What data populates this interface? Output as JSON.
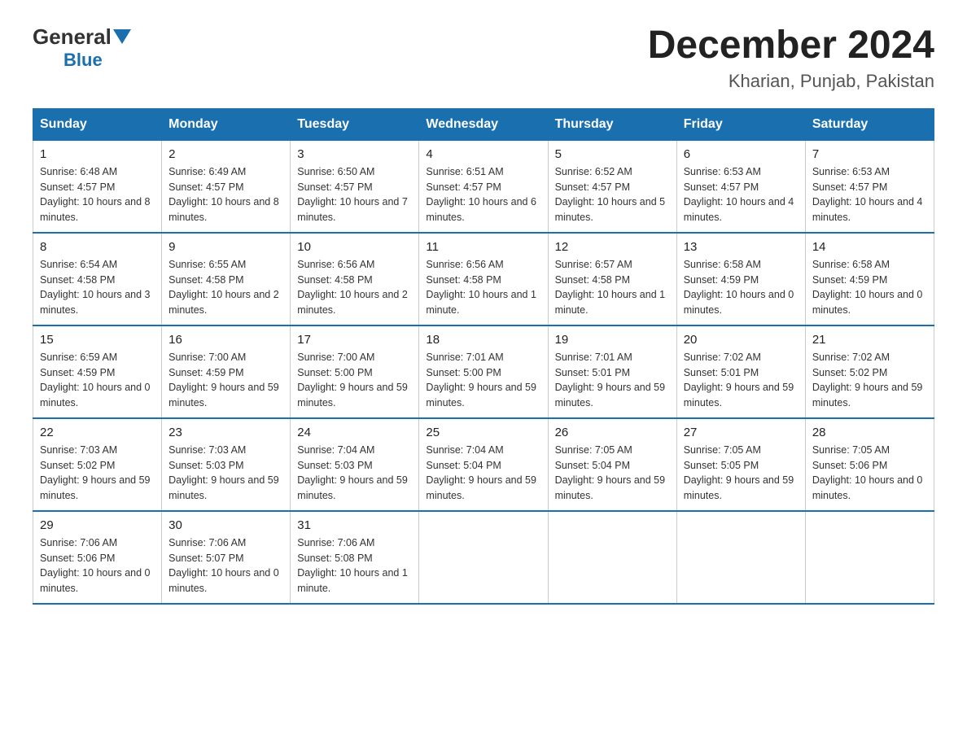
{
  "header": {
    "logo_general": "General",
    "logo_blue": "Blue",
    "month_title": "December 2024",
    "location": "Kharian, Punjab, Pakistan"
  },
  "days_of_week": [
    "Sunday",
    "Monday",
    "Tuesday",
    "Wednesday",
    "Thursday",
    "Friday",
    "Saturday"
  ],
  "weeks": [
    [
      {
        "day": "1",
        "sunrise": "Sunrise: 6:48 AM",
        "sunset": "Sunset: 4:57 PM",
        "daylight": "Daylight: 10 hours and 8 minutes."
      },
      {
        "day": "2",
        "sunrise": "Sunrise: 6:49 AM",
        "sunset": "Sunset: 4:57 PM",
        "daylight": "Daylight: 10 hours and 8 minutes."
      },
      {
        "day": "3",
        "sunrise": "Sunrise: 6:50 AM",
        "sunset": "Sunset: 4:57 PM",
        "daylight": "Daylight: 10 hours and 7 minutes."
      },
      {
        "day": "4",
        "sunrise": "Sunrise: 6:51 AM",
        "sunset": "Sunset: 4:57 PM",
        "daylight": "Daylight: 10 hours and 6 minutes."
      },
      {
        "day": "5",
        "sunrise": "Sunrise: 6:52 AM",
        "sunset": "Sunset: 4:57 PM",
        "daylight": "Daylight: 10 hours and 5 minutes."
      },
      {
        "day": "6",
        "sunrise": "Sunrise: 6:53 AM",
        "sunset": "Sunset: 4:57 PM",
        "daylight": "Daylight: 10 hours and 4 minutes."
      },
      {
        "day": "7",
        "sunrise": "Sunrise: 6:53 AM",
        "sunset": "Sunset: 4:57 PM",
        "daylight": "Daylight: 10 hours and 4 minutes."
      }
    ],
    [
      {
        "day": "8",
        "sunrise": "Sunrise: 6:54 AM",
        "sunset": "Sunset: 4:58 PM",
        "daylight": "Daylight: 10 hours and 3 minutes."
      },
      {
        "day": "9",
        "sunrise": "Sunrise: 6:55 AM",
        "sunset": "Sunset: 4:58 PM",
        "daylight": "Daylight: 10 hours and 2 minutes."
      },
      {
        "day": "10",
        "sunrise": "Sunrise: 6:56 AM",
        "sunset": "Sunset: 4:58 PM",
        "daylight": "Daylight: 10 hours and 2 minutes."
      },
      {
        "day": "11",
        "sunrise": "Sunrise: 6:56 AM",
        "sunset": "Sunset: 4:58 PM",
        "daylight": "Daylight: 10 hours and 1 minute."
      },
      {
        "day": "12",
        "sunrise": "Sunrise: 6:57 AM",
        "sunset": "Sunset: 4:58 PM",
        "daylight": "Daylight: 10 hours and 1 minute."
      },
      {
        "day": "13",
        "sunrise": "Sunrise: 6:58 AM",
        "sunset": "Sunset: 4:59 PM",
        "daylight": "Daylight: 10 hours and 0 minutes."
      },
      {
        "day": "14",
        "sunrise": "Sunrise: 6:58 AM",
        "sunset": "Sunset: 4:59 PM",
        "daylight": "Daylight: 10 hours and 0 minutes."
      }
    ],
    [
      {
        "day": "15",
        "sunrise": "Sunrise: 6:59 AM",
        "sunset": "Sunset: 4:59 PM",
        "daylight": "Daylight: 10 hours and 0 minutes."
      },
      {
        "day": "16",
        "sunrise": "Sunrise: 7:00 AM",
        "sunset": "Sunset: 4:59 PM",
        "daylight": "Daylight: 9 hours and 59 minutes."
      },
      {
        "day": "17",
        "sunrise": "Sunrise: 7:00 AM",
        "sunset": "Sunset: 5:00 PM",
        "daylight": "Daylight: 9 hours and 59 minutes."
      },
      {
        "day": "18",
        "sunrise": "Sunrise: 7:01 AM",
        "sunset": "Sunset: 5:00 PM",
        "daylight": "Daylight: 9 hours and 59 minutes."
      },
      {
        "day": "19",
        "sunrise": "Sunrise: 7:01 AM",
        "sunset": "Sunset: 5:01 PM",
        "daylight": "Daylight: 9 hours and 59 minutes."
      },
      {
        "day": "20",
        "sunrise": "Sunrise: 7:02 AM",
        "sunset": "Sunset: 5:01 PM",
        "daylight": "Daylight: 9 hours and 59 minutes."
      },
      {
        "day": "21",
        "sunrise": "Sunrise: 7:02 AM",
        "sunset": "Sunset: 5:02 PM",
        "daylight": "Daylight: 9 hours and 59 minutes."
      }
    ],
    [
      {
        "day": "22",
        "sunrise": "Sunrise: 7:03 AM",
        "sunset": "Sunset: 5:02 PM",
        "daylight": "Daylight: 9 hours and 59 minutes."
      },
      {
        "day": "23",
        "sunrise": "Sunrise: 7:03 AM",
        "sunset": "Sunset: 5:03 PM",
        "daylight": "Daylight: 9 hours and 59 minutes."
      },
      {
        "day": "24",
        "sunrise": "Sunrise: 7:04 AM",
        "sunset": "Sunset: 5:03 PM",
        "daylight": "Daylight: 9 hours and 59 minutes."
      },
      {
        "day": "25",
        "sunrise": "Sunrise: 7:04 AM",
        "sunset": "Sunset: 5:04 PM",
        "daylight": "Daylight: 9 hours and 59 minutes."
      },
      {
        "day": "26",
        "sunrise": "Sunrise: 7:05 AM",
        "sunset": "Sunset: 5:04 PM",
        "daylight": "Daylight: 9 hours and 59 minutes."
      },
      {
        "day": "27",
        "sunrise": "Sunrise: 7:05 AM",
        "sunset": "Sunset: 5:05 PM",
        "daylight": "Daylight: 9 hours and 59 minutes."
      },
      {
        "day": "28",
        "sunrise": "Sunrise: 7:05 AM",
        "sunset": "Sunset: 5:06 PM",
        "daylight": "Daylight: 10 hours and 0 minutes."
      }
    ],
    [
      {
        "day": "29",
        "sunrise": "Sunrise: 7:06 AM",
        "sunset": "Sunset: 5:06 PM",
        "daylight": "Daylight: 10 hours and 0 minutes."
      },
      {
        "day": "30",
        "sunrise": "Sunrise: 7:06 AM",
        "sunset": "Sunset: 5:07 PM",
        "daylight": "Daylight: 10 hours and 0 minutes."
      },
      {
        "day": "31",
        "sunrise": "Sunrise: 7:06 AM",
        "sunset": "Sunset: 5:08 PM",
        "daylight": "Daylight: 10 hours and 1 minute."
      },
      {
        "day": "",
        "sunrise": "",
        "sunset": "",
        "daylight": ""
      },
      {
        "day": "",
        "sunrise": "",
        "sunset": "",
        "daylight": ""
      },
      {
        "day": "",
        "sunrise": "",
        "sunset": "",
        "daylight": ""
      },
      {
        "day": "",
        "sunrise": "",
        "sunset": "",
        "daylight": ""
      }
    ]
  ]
}
